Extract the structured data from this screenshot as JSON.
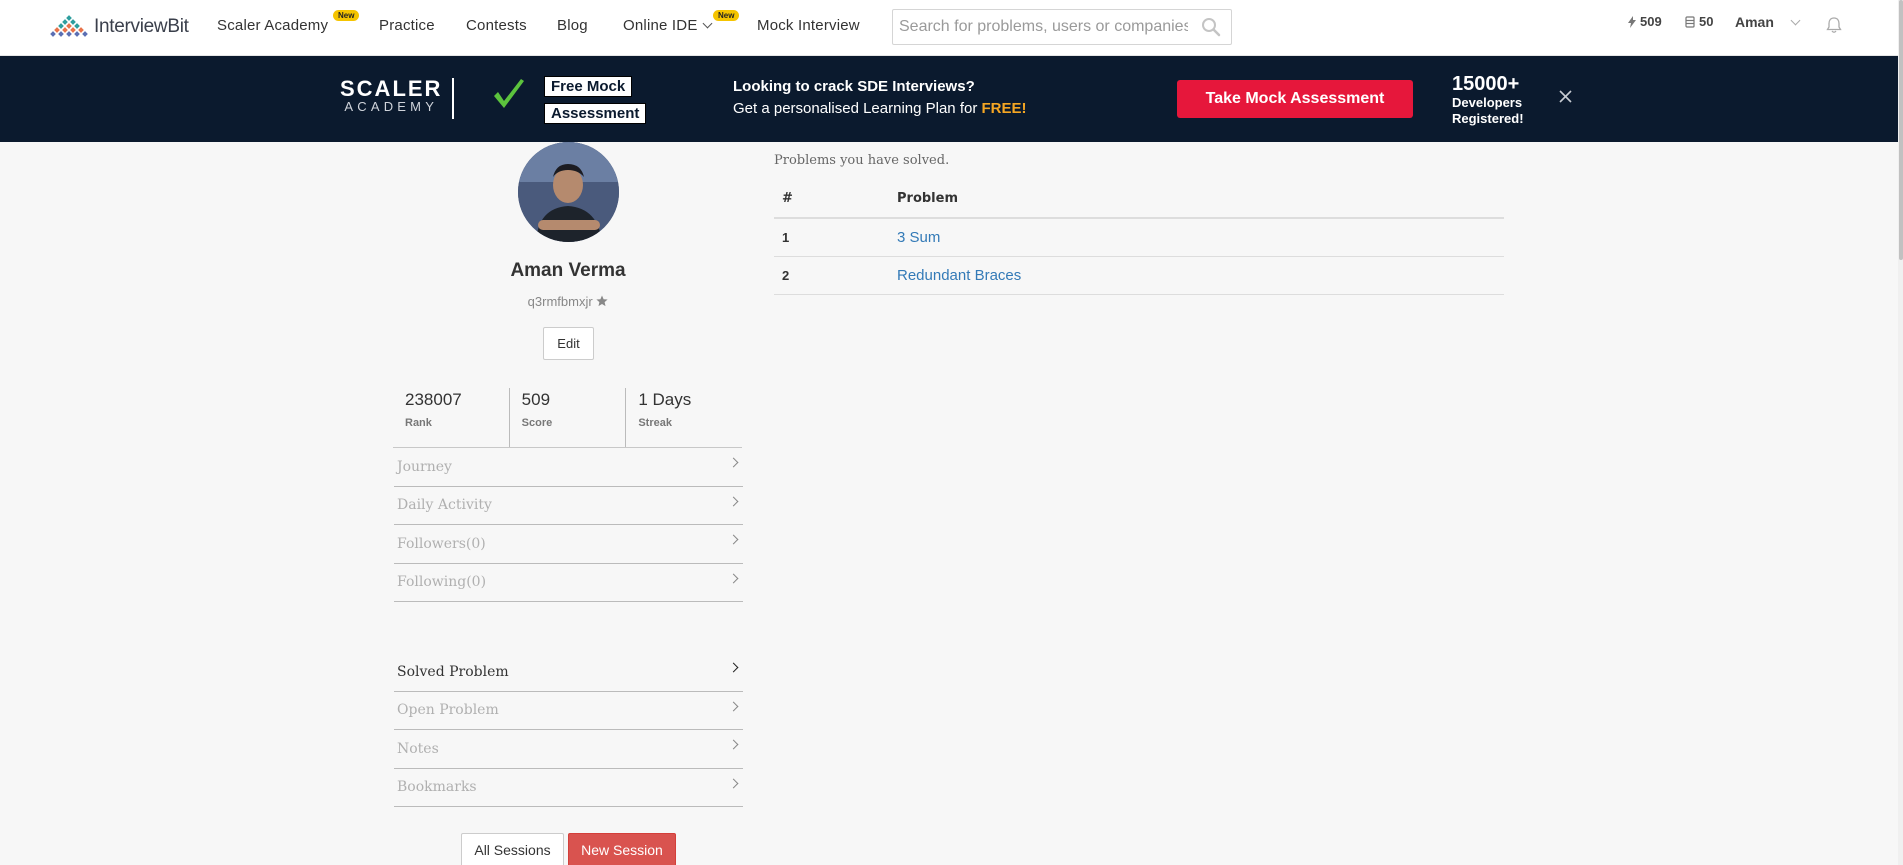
{
  "nav": {
    "logo_text": "InterviewBit",
    "links": {
      "scaler": "Scaler Academy",
      "practice": "Practice",
      "contests": "Contests",
      "blog": "Blog",
      "ide": "Online IDE",
      "mock": "Mock Interview"
    },
    "new_badge": "New",
    "search_placeholder": "Search for problems, users or companies",
    "score": "509",
    "coins": "50",
    "user": "Aman"
  },
  "banner": {
    "scaler_line1": "SCALER",
    "scaler_line2": "ACADEMY",
    "tag1": "Free Mock",
    "tag2": "Assessment",
    "headline": "Looking to crack SDE Interviews?",
    "sub_prefix": "Get a personalised Learning Plan for ",
    "sub_free": "FREE!",
    "cta": "Take Mock Assessment",
    "count": "15000+",
    "count_line2": "Developers",
    "count_line3": "Registered!"
  },
  "profile": {
    "name": "Aman Verma",
    "handle": "q3rmfbmxjr",
    "edit": "Edit",
    "stats": [
      {
        "value": "238007",
        "label": "Rank"
      },
      {
        "value": "509",
        "label": "Score"
      },
      {
        "value": "1 Days",
        "label": "Streak"
      }
    ],
    "menu1": [
      "Journey",
      "Daily Activity",
      "Followers(0)",
      "Following(0)"
    ],
    "menu2": [
      "Solved Problem",
      "Open Problem",
      "Notes",
      "Bookmarks"
    ],
    "all_sessions": "All Sessions",
    "new_session": "New Session"
  },
  "solved": {
    "caption": "Problems you have solved.",
    "headers": [
      "#",
      "Problem"
    ],
    "rows": [
      {
        "num": "1",
        "problem": "3 Sum"
      },
      {
        "num": "2",
        "problem": "Redundant Braces"
      }
    ]
  },
  "colors": {
    "banner_bg": "#0b1a2e",
    "cta": "#e6173b",
    "free": "#f5a623",
    "new_session": "#d9534f",
    "link": "#337ab7"
  }
}
